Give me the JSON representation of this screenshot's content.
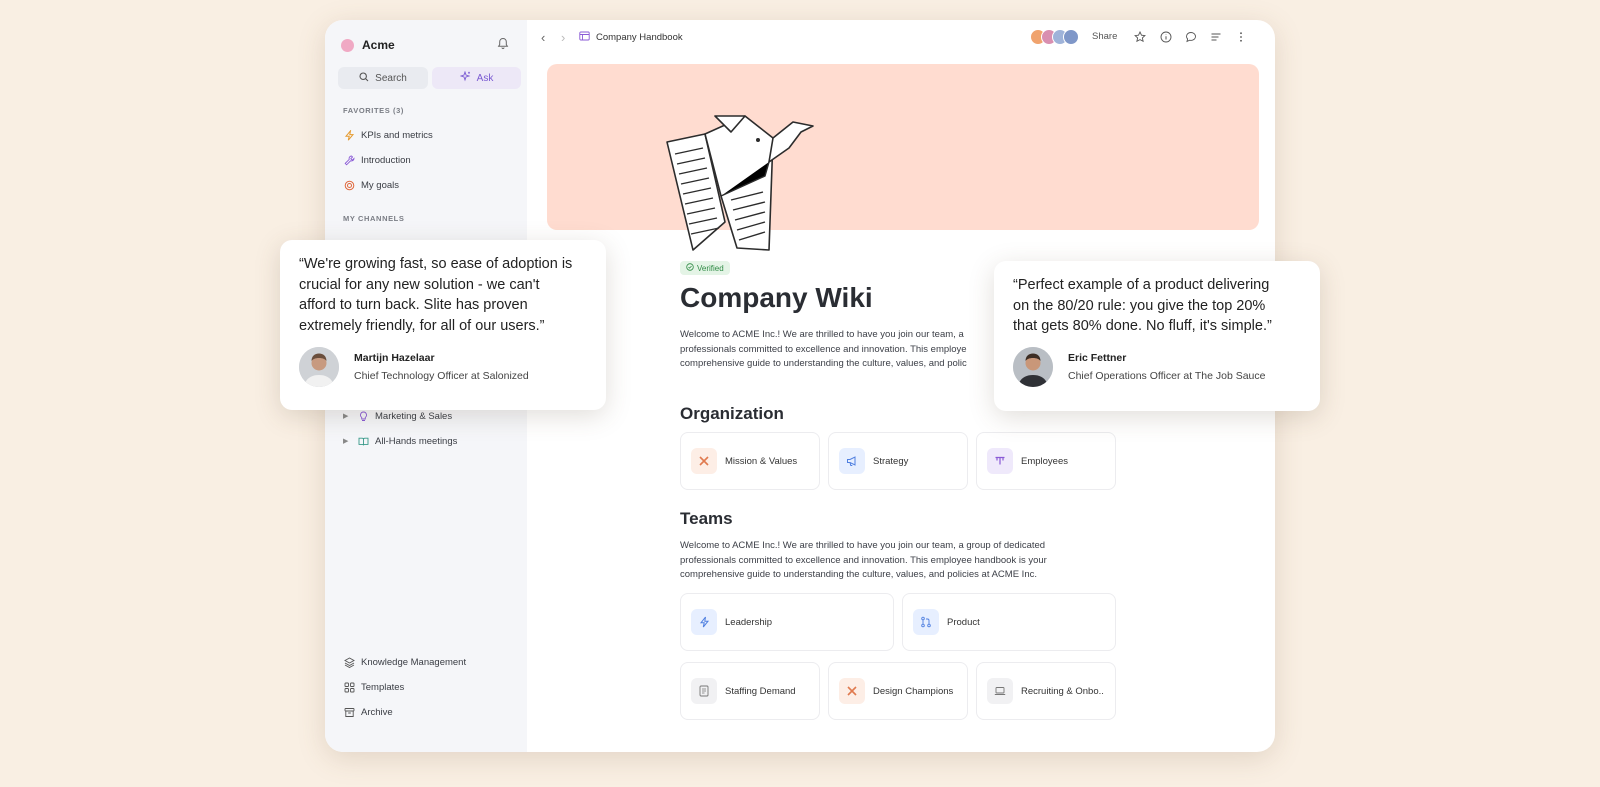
{
  "workspace": {
    "name": "Acme"
  },
  "sidebar": {
    "search_label": "Search",
    "ask_label": "Ask",
    "favorites_label": "FAVORITES (3)",
    "favorites": [
      {
        "label": "KPIs and metrics",
        "icon": "lightning-icon"
      },
      {
        "label": "Introduction",
        "icon": "wrench-icon"
      },
      {
        "label": "My goals",
        "icon": "target-icon"
      }
    ],
    "channels_label": "MY CHANNELS",
    "channels": [
      {
        "label": "Marketing & Sales",
        "icon": "lightbulb-icon"
      },
      {
        "label": "All-Hands meetings",
        "icon": "book-icon"
      }
    ],
    "footer": [
      {
        "label": "Knowledge Management",
        "icon": "layers-icon"
      },
      {
        "label": "Templates",
        "icon": "grid-icon"
      },
      {
        "label": "Archive",
        "icon": "archive-icon"
      }
    ]
  },
  "topbar": {
    "breadcrumb": "Company Handbook",
    "share_label": "Share"
  },
  "doc": {
    "verified": "Verified",
    "title": "Company Wiki",
    "intro_lines": [
      "Welcome to ACME Inc.! We are thrilled to have you join our team, a",
      "professionals committed to excellence and innovation. This employe",
      "comprehensive guide to understanding the culture, values, and polic"
    ],
    "organization_heading": "Organization",
    "organization_cards": [
      {
        "label": "Mission & Values",
        "icon": "tools-icon",
        "bg": "#fdeee6",
        "fg": "#e07a4f"
      },
      {
        "label": "Strategy",
        "icon": "megaphone-icon",
        "bg": "#e7efff",
        "fg": "#4f7fe0"
      },
      {
        "label": "Employees",
        "icon": "users-icon",
        "bg": "#efe9fb",
        "fg": "#8a5ad6"
      }
    ],
    "teams_heading": "Teams",
    "teams_lines": [
      "Welcome to ACME Inc.! We are thrilled to have you join our team, a group of dedicated",
      "professionals committed to excellence and innovation. This employee handbook is your",
      "comprehensive guide to understanding the culture, values, and policies at ACME Inc."
    ],
    "team_cards": [
      {
        "label": "Leadership",
        "icon": "lightning-icon",
        "bg": "#e7efff",
        "fg": "#4f7fe0"
      },
      {
        "label": "Product",
        "icon": "branch-icon",
        "bg": "#e7efff",
        "fg": "#4f7fe0"
      },
      {
        "label": "Staffing Demand",
        "icon": "document-icon",
        "bg": "#f1f1f3",
        "fg": "#777"
      },
      {
        "label": "Design Champions",
        "icon": "tools-icon",
        "bg": "#fdeee6",
        "fg": "#e07a4f"
      },
      {
        "label": "Recruiting & Onbo..",
        "icon": "laptop-icon",
        "bg": "#f1f1f3",
        "fg": "#777"
      }
    ]
  },
  "quotes": [
    {
      "lines": [
        "“We're growing fast, so ease of adoption is",
        "crucial for any new solution - we can't",
        "afford to turn back. Slite has proven",
        "extremely friendly, for all of our users.”"
      ],
      "name": "Martijn Hazelaar",
      "role": "Chief Technology Officer at Salonized"
    },
    {
      "lines": [
        "“Perfect example of a product delivering",
        "on the 80/20 rule: you give the top 20%",
        "that gets 80% done. No fluff, it's simple.”"
      ],
      "name": "Eric Fettner",
      "role": "Chief Operations Officer at The Job Sauce"
    }
  ]
}
